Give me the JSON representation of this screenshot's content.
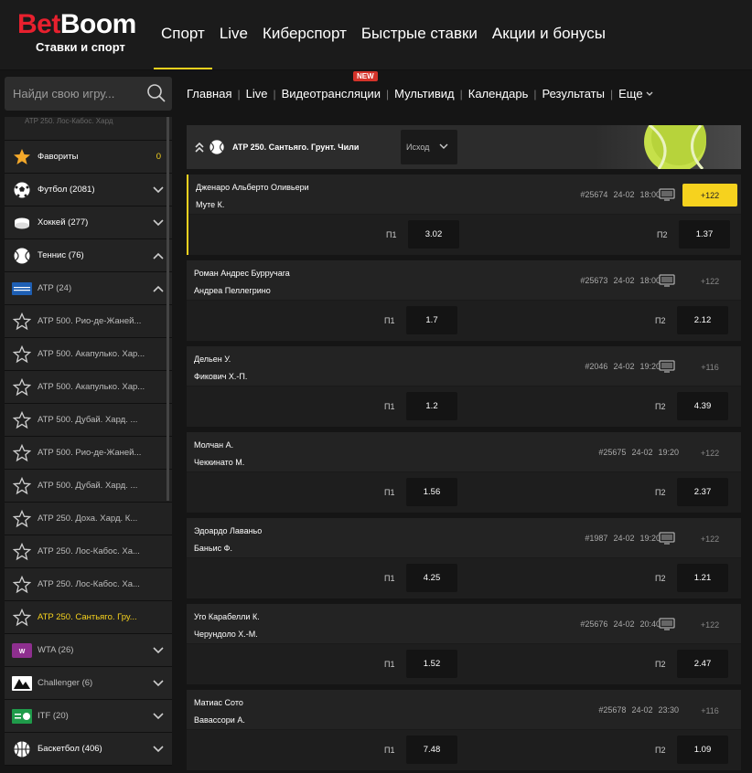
{
  "brand": {
    "name_part1": "Bet",
    "name_part2": "Boom",
    "tagline": "Ставки и спорт",
    "color_red": "#e8202e",
    "accent": "#f6d21e"
  },
  "main_nav": [
    {
      "label": "Спорт",
      "active": true
    },
    {
      "label": "Live"
    },
    {
      "label": "Киберспорт"
    },
    {
      "label": "Быстрые ставки"
    },
    {
      "label": "Акции и бонусы"
    }
  ],
  "search": {
    "placeholder": "Найди свою игру..."
  },
  "sub_nav": {
    "items": [
      "Главная",
      "Live",
      "Видеотрансляции",
      "Мультивид",
      "Календарь",
      "Результаты",
      "Еще"
    ],
    "new_badge": "NEW",
    "separator": "|"
  },
  "sidebar": {
    "partial_top": "ATP 250. Лос-Кабос. Хард",
    "favorites": {
      "label": "Фавориты",
      "count": "0"
    },
    "sports": [
      {
        "label": "Футбол (2081)",
        "icon": "football-icon"
      },
      {
        "label": "Хоккей (277)",
        "icon": "hockey-icon"
      },
      {
        "label": "Теннис (76)",
        "icon": "tennis-icon"
      }
    ],
    "atp": {
      "label": "ATP (24)"
    },
    "leagues": [
      "ATP 500. Рио-де-Жаней...",
      "ATP 500. Акапулько. Хар...",
      "ATP 500. Акапулько. Хар...",
      "ATP 500. Дубай. Хард. ...",
      "ATP 500. Рио-де-Жаней...",
      "ATP 500. Дубай. Хард. ...",
      "ATP 250. Доха. Хард. К...",
      "ATP 250. Лос-Кабос. Ха...",
      "ATP 250. Лос-Кабос. Ха...",
      "ATP 250. Сантьяго. Гру..."
    ],
    "groups": [
      {
        "label": "WTA (26)"
      },
      {
        "label": "Challenger (6)"
      },
      {
        "label": "ITF (20)"
      }
    ],
    "basketball": {
      "label": "Баскетбол (406)"
    }
  },
  "league_header": {
    "title": "ATP 250. Сантьяго. Грунт. Чили",
    "select_value": "Исход"
  },
  "odds_labels": {
    "p1": "П1",
    "p2": "П2"
  },
  "events": [
    {
      "team1": "Дженаро Альберто Оливьери",
      "team2": "Муте К.",
      "id": "#25674",
      "date": "24-02",
      "time": "18:00",
      "more": "+122",
      "p1": "3.02",
      "p2": "1.37",
      "selected": true
    },
    {
      "team1": "Роман Андрес Бурручага",
      "team2": "Андреа Пеллегрино",
      "id": "#25673",
      "date": "24-02",
      "time": "18:00",
      "more": "+122",
      "p1": "1.7",
      "p2": "2.12"
    },
    {
      "team1": "Дельен У.",
      "team2": "Фикович Х.-П.",
      "id": "#2046",
      "date": "24-02",
      "time": "19:20",
      "more": "+116",
      "p1": "1.2",
      "p2": "4.39"
    },
    {
      "team1": "Молчан А.",
      "team2": "Чеккинато М.",
      "id": "#25675",
      "date": "24-02",
      "time": "19:20",
      "more": "+122",
      "p1": "1.56",
      "p2": "2.37",
      "no_tv": true
    },
    {
      "team1": "Эдоардо Лаваньо",
      "team2": "Баньис Ф.",
      "id": "#1987",
      "date": "24-02",
      "time": "19:20",
      "more": "+122",
      "p1": "4.25",
      "p2": "1.21"
    },
    {
      "team1": "Уго Карабелли К.",
      "team2": "Черундоло Х.-М.",
      "id": "#25676",
      "date": "24-02",
      "time": "20:40",
      "more": "+122",
      "p1": "1.52",
      "p2": "2.47"
    },
    {
      "team1": "Матиас Сото",
      "team2": "Вавассори А.",
      "id": "#25678",
      "date": "24-02",
      "time": "23:30",
      "more": "+116",
      "p1": "7.48",
      "p2": "1.09",
      "no_tv": true
    }
  ]
}
